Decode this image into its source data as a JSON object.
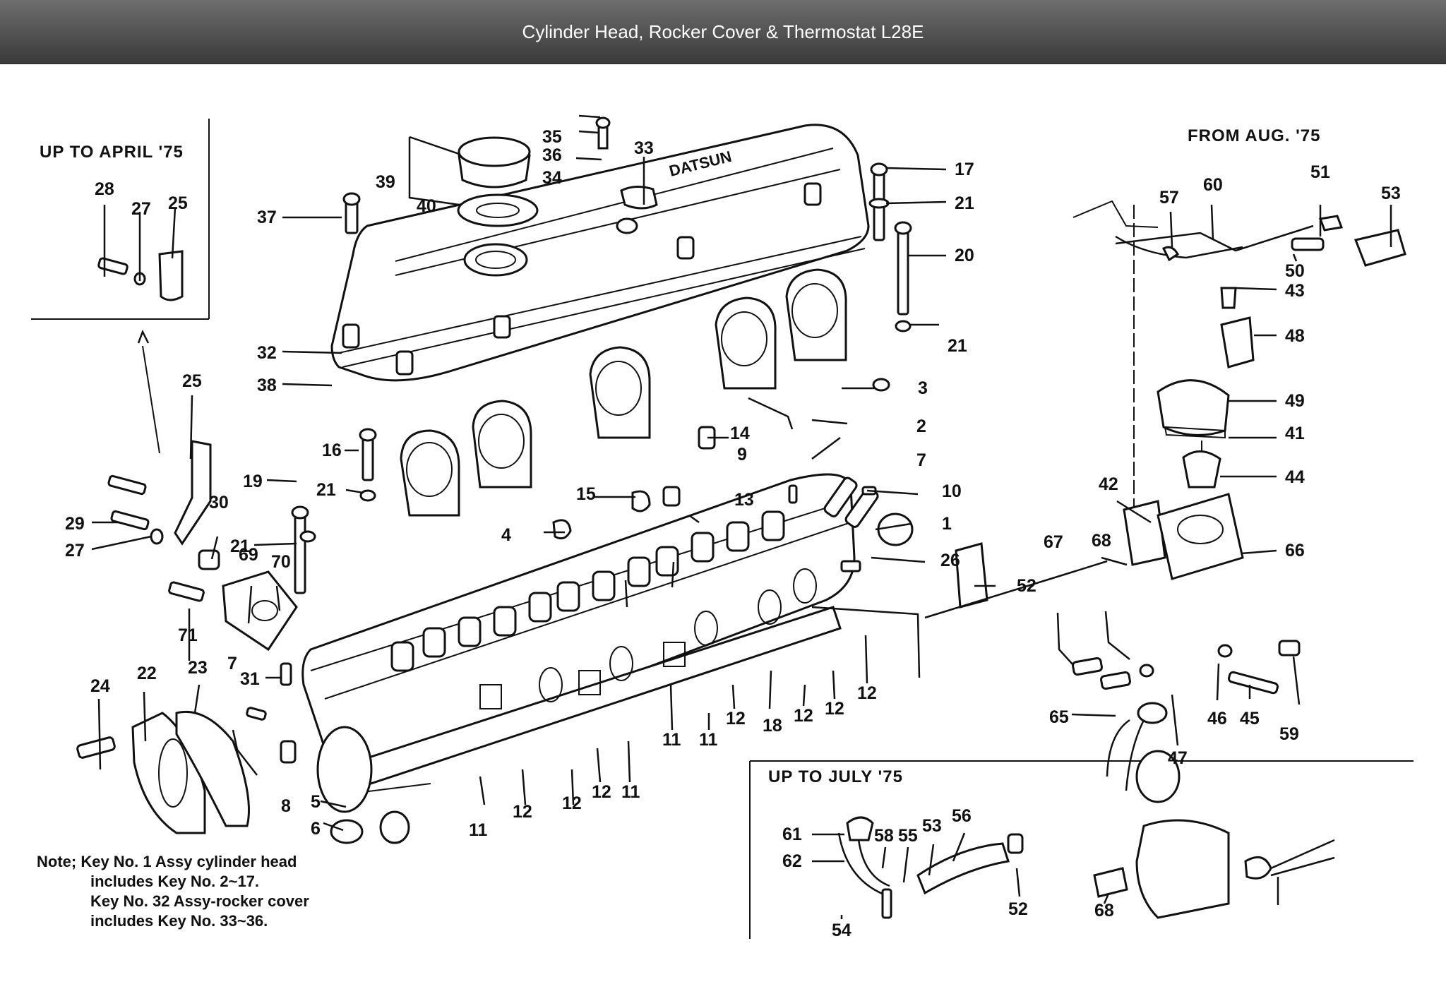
{
  "header": {
    "title": "Cylinder Head, Rocker Cover & Thermostat L28E"
  },
  "insets": {
    "top_left": "UP TO APRIL '75",
    "top_right": "FROM AUG. '75",
    "bottom_right": "UP TO JULY '75"
  },
  "note": {
    "line1": "Note; Key No. 1 Assy cylinder head",
    "line2": "includes Key No. 2~17.",
    "line3": "Key No. 32 Assy-rocker cover",
    "line4": "includes Key No. 33~36."
  },
  "labels": [
    "28",
    "27",
    "25",
    "39",
    "40",
    "35",
    "36",
    "34",
    "33",
    "17",
    "21",
    "20",
    "21",
    "37",
    "32",
    "38",
    "25",
    "29",
    "27",
    "30",
    "19",
    "16",
    "21",
    "21",
    "69",
    "70",
    "71",
    "24",
    "22",
    "23",
    "7",
    "31",
    "8",
    "5",
    "6",
    "11",
    "12",
    "12",
    "12",
    "11",
    "11",
    "11",
    "12",
    "12",
    "12",
    "12",
    "18",
    "14",
    "9",
    "13",
    "15",
    "4",
    "3",
    "2",
    "7",
    "10",
    "1",
    "26",
    "52",
    "57",
    "60",
    "51",
    "53",
    "50",
    "43",
    "48",
    "49",
    "41",
    "44",
    "42",
    "66",
    "67",
    "68",
    "65",
    "47",
    "46",
    "45",
    "59",
    "61",
    "62",
    "58",
    "55",
    "53",
    "56",
    "54",
    "52",
    "68"
  ]
}
